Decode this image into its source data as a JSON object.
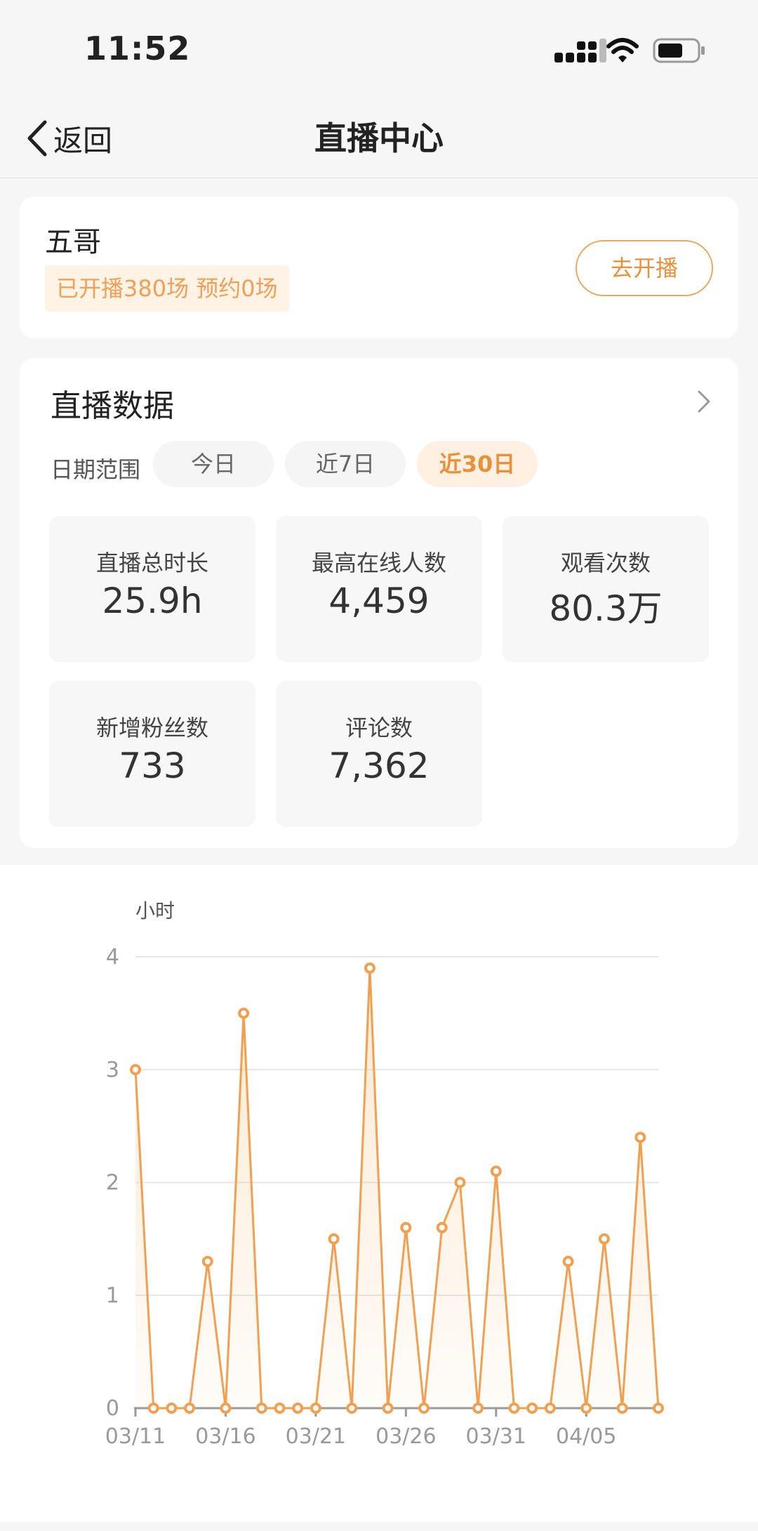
{
  "status": {
    "time": "11:52"
  },
  "nav": {
    "back_label": "返回",
    "title": "直播中心"
  },
  "user": {
    "name": "五哥",
    "stats": "已开播380场 预约0场",
    "go_live_label": "去开播"
  },
  "live_data": {
    "title": "直播数据",
    "range_label": "日期范围",
    "ranges": [
      "今日",
      "近7日",
      "近30日"
    ],
    "active_range": "近30日",
    "metrics": [
      {
        "label": "直播总时长",
        "value": "25.9h"
      },
      {
        "label": "最高在线人数",
        "value": "4,459"
      },
      {
        "label": "观看次数",
        "value": "80.3万"
      },
      {
        "label": "新增粉丝数",
        "value": "733"
      },
      {
        "label": "评论数",
        "value": "7,362"
      }
    ]
  },
  "colors": {
    "accent": "#e8913a",
    "line": "#f0a050",
    "tag_bg": "#fff3e6"
  },
  "chart_data": {
    "type": "area",
    "ylabel": "小时",
    "ylim": [
      0,
      4
    ],
    "yticks": [
      0,
      1,
      2,
      3,
      4
    ],
    "xtick_labels": [
      "03/11",
      "03/16",
      "03/21",
      "03/26",
      "03/31",
      "04/05"
    ],
    "x": [
      "03/11",
      "03/12",
      "03/13",
      "03/14",
      "03/15",
      "03/16",
      "03/17",
      "03/18",
      "03/19",
      "03/20",
      "03/21",
      "03/22",
      "03/23",
      "03/24",
      "03/25",
      "03/26",
      "03/27",
      "03/28",
      "03/29",
      "03/30",
      "03/31",
      "04/01",
      "04/02",
      "04/03",
      "04/04",
      "04/05",
      "04/06",
      "04/07",
      "04/08",
      "04/09"
    ],
    "values": [
      3.0,
      0,
      0,
      0,
      1.3,
      0,
      3.5,
      0,
      0,
      0,
      0,
      1.5,
      0,
      3.9,
      0,
      1.6,
      0,
      1.6,
      2.0,
      0,
      2.1,
      0,
      0,
      0,
      1.3,
      0,
      1.5,
      0,
      2.4,
      0
    ],
    "grid": true
  }
}
